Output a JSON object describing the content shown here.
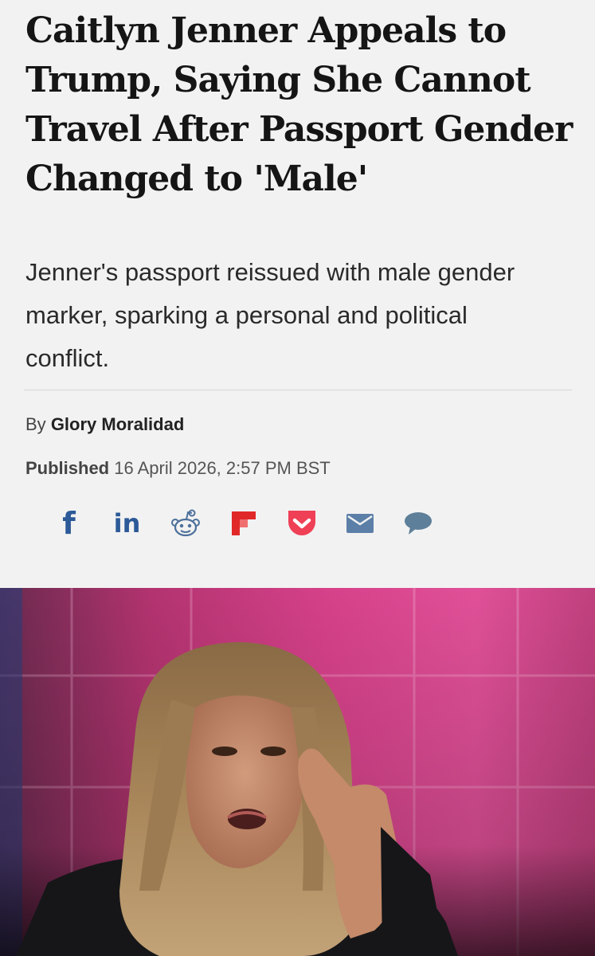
{
  "article": {
    "headline": "Caitlyn Jenner Appeals to Trump, Saying She Cannot Travel After Passport Gender Changed to 'Male'",
    "dek": "Jenner's passport reissued with male gender marker, sparking a personal and political conflict.",
    "byline_prefix": "By",
    "author": "Glory Moralidad",
    "published_label": "Published",
    "published_date": "16 April 2026, 2:57 PM BST"
  },
  "share": {
    "icons": [
      "facebook-icon",
      "linkedin-icon",
      "reddit-icon",
      "flipboard-icon",
      "pocket-icon",
      "email-icon",
      "comment-icon"
    ],
    "facebook_glyph": "f",
    "linkedin_glyph": "in"
  },
  "colors": {
    "share_blue": "#2c5a98",
    "reddit": "#4c6f9a",
    "flipboard": "#e12828",
    "pocket": "#ef4056",
    "email": "#5c7fa8",
    "comment": "#5e7f99",
    "background": "#f2f2f2"
  }
}
